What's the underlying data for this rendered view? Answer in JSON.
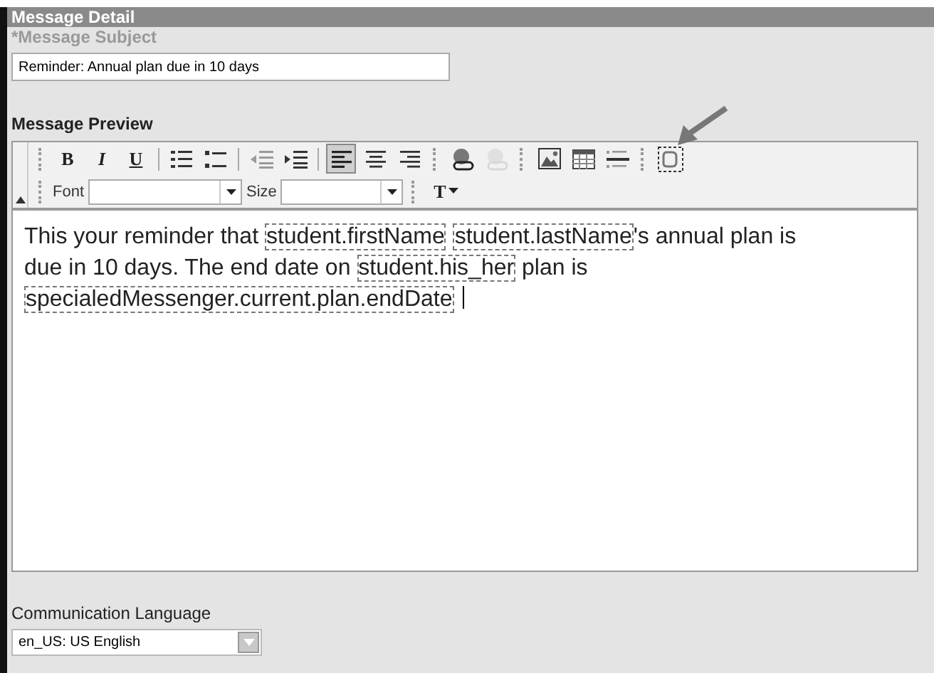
{
  "panel": {
    "title": "Message Detail"
  },
  "subject": {
    "label": "*Message Subject",
    "value": "Reminder: Annual plan due in 10 days"
  },
  "preview": {
    "label": "Message Preview",
    "toolbar": [
      {
        "label": "B",
        "selected": false,
        "disabled": false
      },
      {
        "label": "I",
        "selected": false,
        "disabled": false
      },
      {
        "label": "U",
        "selected": false,
        "disabled": false
      },
      {
        "selected": false,
        "disabled": false
      },
      {
        "selected": false,
        "disabled": false
      },
      {
        "selected": false,
        "disabled": true
      },
      {
        "selected": false,
        "disabled": false
      },
      {
        "selected": true,
        "disabled": false
      },
      {
        "selected": false,
        "disabled": false
      },
      {
        "selected": false,
        "disabled": false
      },
      {
        "selected": false,
        "disabled": false
      },
      {
        "selected": false,
        "disabled": true
      },
      {
        "selected": false,
        "disabled": false
      },
      {
        "selected": false,
        "disabled": false
      },
      {
        "selected": false,
        "disabled": false
      },
      {
        "selected": false,
        "disabled": false
      }
    ],
    "font_label": "Font",
    "size_label": "Size",
    "text_color": "T",
    "body": [
      {
        "kind": "text",
        "text": "This your reminder that "
      },
      {
        "kind": "field",
        "text": "student.firstName"
      },
      {
        "kind": "field",
        "text": "student.lastName"
      },
      {
        "kind": "text",
        "text": "'s annual plan is due in 10 days. The end date on "
      },
      {
        "kind": "field",
        "text": "student.his_her"
      },
      {
        "kind": "text",
        "text": " plan is "
      },
      {
        "kind": "field",
        "text": "specialedMessenger.current.plan.endDate"
      }
    ]
  },
  "language": {
    "label": "Communication Language",
    "value": "en_US: US English"
  }
}
